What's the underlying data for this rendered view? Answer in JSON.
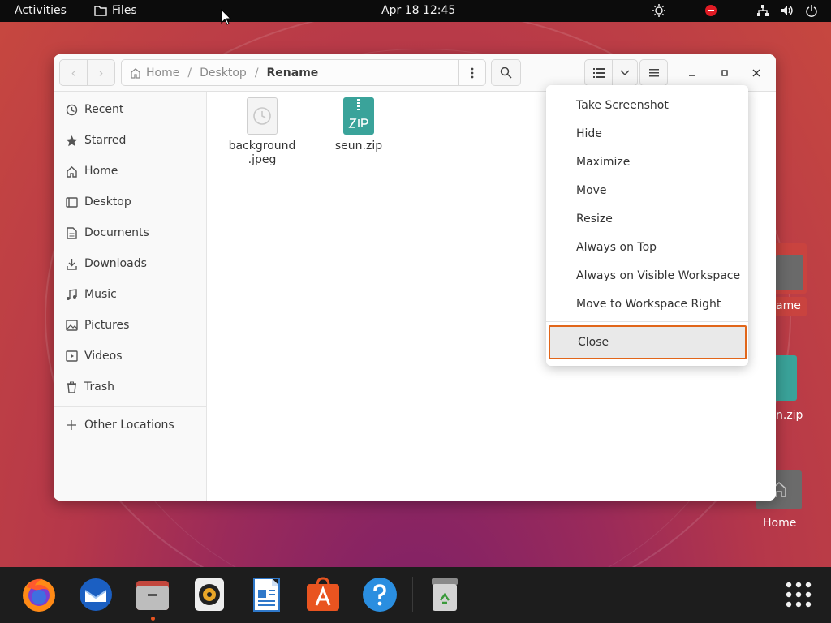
{
  "topbar": {
    "activities": "Activities",
    "app_name": "Files",
    "clock": "Apr 18  12:45",
    "tray_icons": [
      "brightness-icon",
      "do-not-disturb-icon",
      "network-icon",
      "volume-icon",
      "power-icon"
    ]
  },
  "window": {
    "path": [
      "Home",
      "Desktop",
      "Rename"
    ],
    "sidebar": [
      {
        "label": "Recent",
        "icon": "clock-icon"
      },
      {
        "label": "Starred",
        "icon": "star-icon"
      },
      {
        "label": "Home",
        "icon": "home-icon"
      },
      {
        "label": "Desktop",
        "icon": "desktop-icon"
      },
      {
        "label": "Documents",
        "icon": "document-icon"
      },
      {
        "label": "Downloads",
        "icon": "download-icon"
      },
      {
        "label": "Music",
        "icon": "music-icon"
      },
      {
        "label": "Pictures",
        "icon": "picture-icon"
      },
      {
        "label": "Videos",
        "icon": "video-icon"
      },
      {
        "label": "Trash",
        "icon": "trash-icon"
      },
      {
        "label": "Other Locations",
        "icon": "plus-icon"
      }
    ],
    "files": [
      {
        "name_line1": "background",
        "name_line2": ".jpeg"
      },
      {
        "name_line1": "seun.zip",
        "name_line2": ""
      }
    ]
  },
  "context_menu": {
    "items": [
      "Take Screenshot",
      "Hide",
      "Maximize",
      "Move",
      "Resize",
      "Always on Top",
      "Always on Visible Workspace",
      "Move to Workspace Right"
    ],
    "close": "Close",
    "highlight_color": "#e1661a"
  },
  "desktop": {
    "rename_fragment": "ame",
    "zip_fragment": "n.zip",
    "home_label": "Home"
  },
  "dock": {
    "apps": [
      "firefox-icon",
      "thunderbird-icon",
      "files-icon",
      "rhythmbox-icon",
      "writer-icon",
      "software-icon",
      "help-icon",
      "trash-icon"
    ],
    "show_apps": "app-grid-icon",
    "accent": "#e95420"
  }
}
